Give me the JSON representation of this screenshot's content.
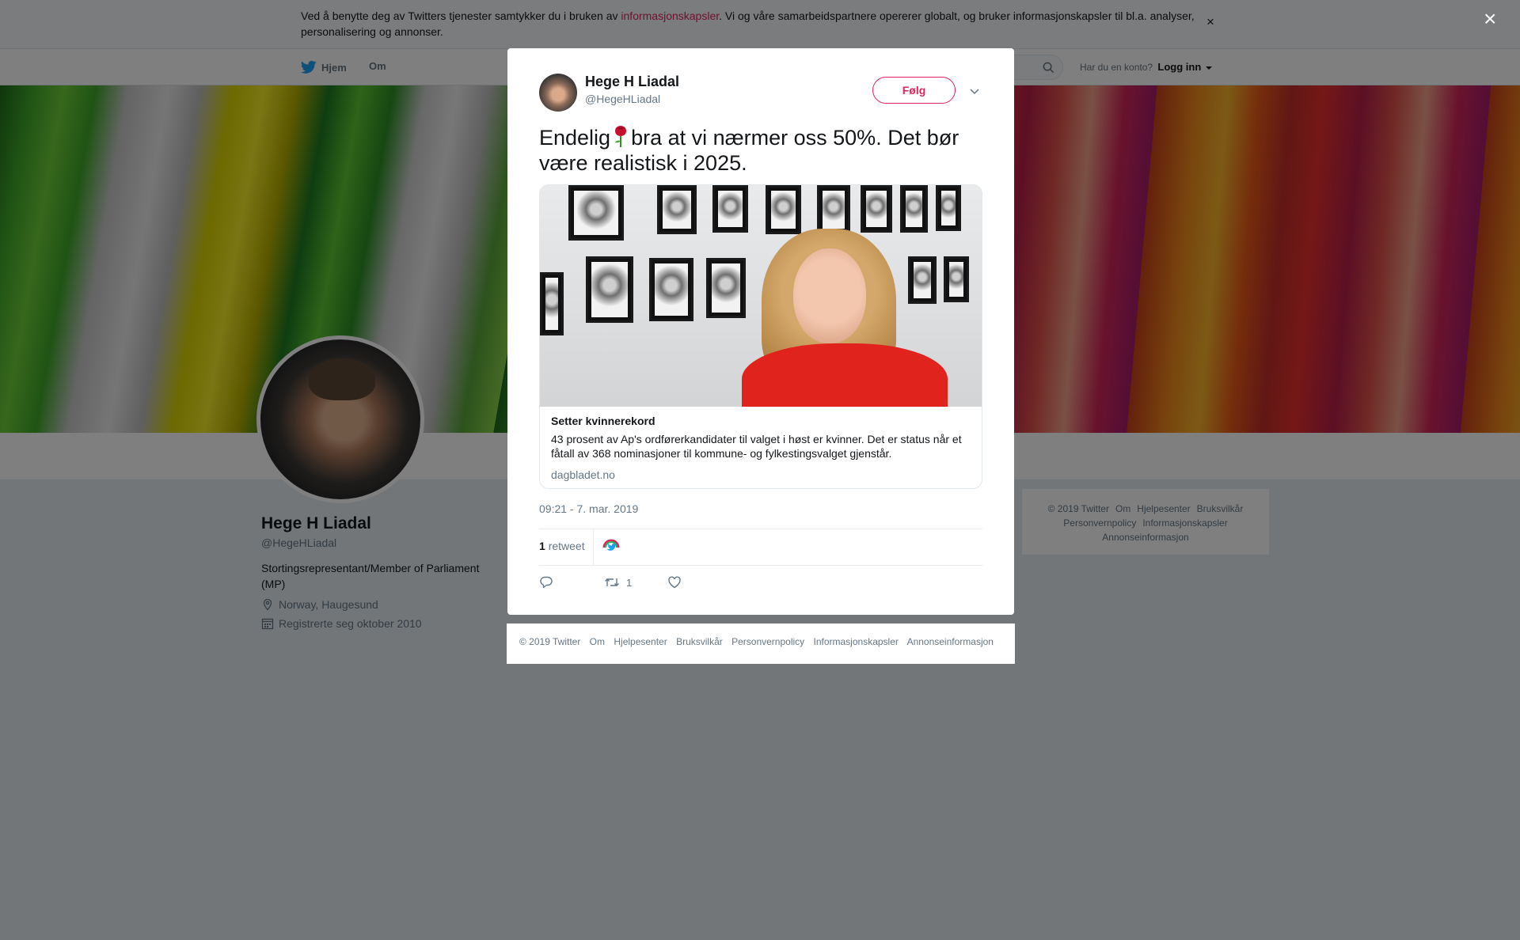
{
  "cookie_bar": {
    "text_before": "Ved å benytte deg av Twitters tjenester samtykker du i bruken av ",
    "link": "informasjonskapsler",
    "text_after": ". Vi og våre samarbeidspartnere opererer globalt, og bruker informasjonskapsler til bl.a. analyser, personalisering og annonser.",
    "close": "×"
  },
  "nav": {
    "home": "Hjem",
    "about": "Om",
    "account_prompt": "Har du en konto?",
    "login": "Logg inn"
  },
  "profile": {
    "name": "Hege H Liadal",
    "handle": "@HegeHLiadal",
    "bio": "Stortingsrepresentant/Member of Parliament (MP)",
    "location": "Norway, Haugesund",
    "joined": "Registrerte seg oktober 2010"
  },
  "side_footer": {
    "items": [
      "© 2019 Twitter",
      "Om",
      "Hjelpesenter",
      "Bruksvilkår",
      "Personvernpolicy",
      "Informasjonskapsler",
      "Annonseinformasjon"
    ]
  },
  "overlay": {
    "close": "×"
  },
  "tweet": {
    "name": "Hege H Liadal",
    "handle": "@HegeHLiadal",
    "follow": "Følg",
    "text_before": "Endelig",
    "text_after": "bra at vi nærmer oss 50%. Det bør være realistisk i 2025.",
    "emoji": "rose-emoji",
    "card": {
      "title": "Setter kvinnerekord",
      "description": "43 prosent av Ap's ordførerkandidater til valget i høst er kvinner. Det er status når et fåtall av 368 nominasjoner til kommune- og fylkestingsvalget gjenstår.",
      "domain": "dagbladet.no"
    },
    "timestamp": "09:21 - 7. mar. 2019",
    "retweet_count": "1",
    "retweet_label": "retweet",
    "actions": {
      "reply_count": "",
      "retweet_count": "1",
      "like_count": ""
    }
  },
  "modal_footer": {
    "items": [
      "© 2019 Twitter",
      "Om",
      "Hjelpesenter",
      "Bruksvilkår",
      "Personvernpolicy",
      "Informasjonskapsler",
      "Annonseinformasjon"
    ]
  },
  "colors": {
    "accent_red": "#e0245e",
    "twitter_blue": "#1da1f2",
    "muted_text": "#657786"
  }
}
